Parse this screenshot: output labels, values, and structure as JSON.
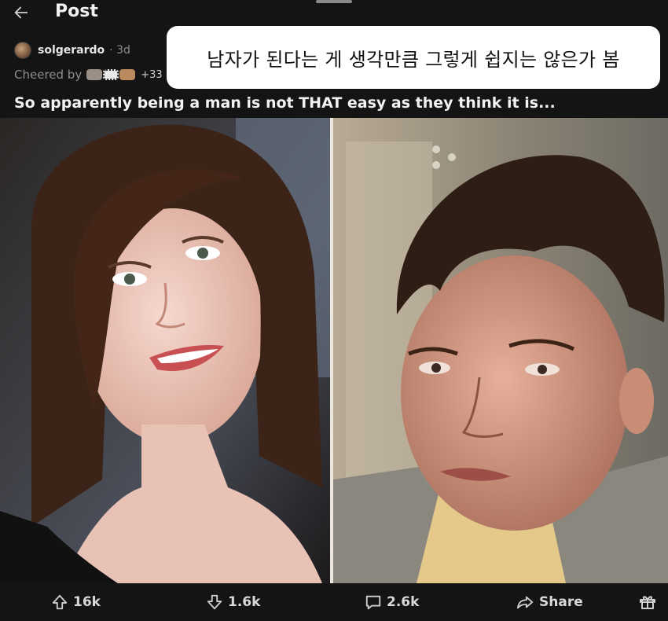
{
  "header": {
    "title": "Post",
    "back_icon": "arrow-left-icon"
  },
  "post": {
    "username": "solgerardo",
    "age": "· 3d",
    "cheered_by_label": "Cheered by",
    "cheer_count": "+33",
    "title": "So apparently being a man is not THAT easy as they think it is...",
    "overlay_caption": "남자가 된다는 게 생각만큼 그렇게 쉽지는 않은가 봄"
  },
  "actions": {
    "upvotes": "16k",
    "downvotes": "1.6k",
    "comments": "2.6k",
    "share_label": "Share"
  },
  "colors": {
    "background": "#141414",
    "text": "#e9e9e9",
    "muted": "#8d8d8d",
    "bubble": "#ffffff"
  }
}
